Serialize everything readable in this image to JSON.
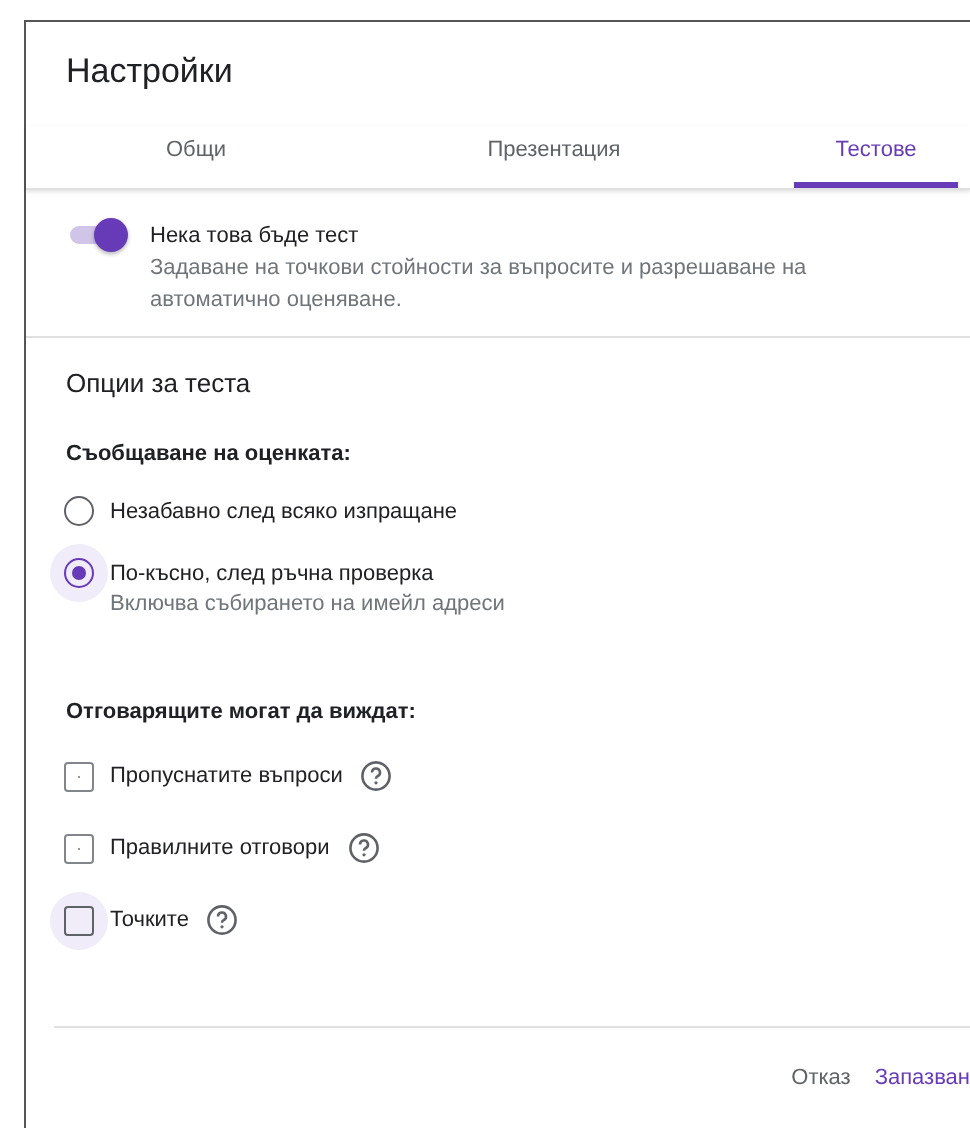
{
  "dialog": {
    "title": "Настройки",
    "tabs": [
      {
        "label": "Общи",
        "selected": false
      },
      {
        "label": "Презентация",
        "selected": false
      },
      {
        "label": "Тестове",
        "selected": true
      }
    ],
    "quiz_toggle": {
      "label": "Нека това бъде тест",
      "description": "Задаване на точкови стойности за въпросите и разрешаване на автоматично оценяване.",
      "on": true
    },
    "section_title": "Опции за теста",
    "grade_release": {
      "label": "Съобщаване на оценката:",
      "options": [
        {
          "label": "Незабавно след всяко изпращане",
          "selected": false
        },
        {
          "label": "По-късно, след ръчна проверка",
          "hint": "Включва събирането на имейл адреси",
          "selected": true
        }
      ]
    },
    "respondents_see": {
      "label": "Отговарящите могат да виждат:",
      "options": [
        {
          "label": "Пропуснатите въпроси",
          "checked": false,
          "disabled": true,
          "focused": false
        },
        {
          "label": "Правилните отговори",
          "checked": false,
          "disabled": true,
          "focused": false
        },
        {
          "label": "Точките",
          "checked": false,
          "disabled": false,
          "focused": true
        }
      ]
    },
    "buttons": [
      {
        "label": "Отказ",
        "kind": "secondary"
      },
      {
        "label": "Запазван",
        "kind": "primary"
      }
    ]
  }
}
